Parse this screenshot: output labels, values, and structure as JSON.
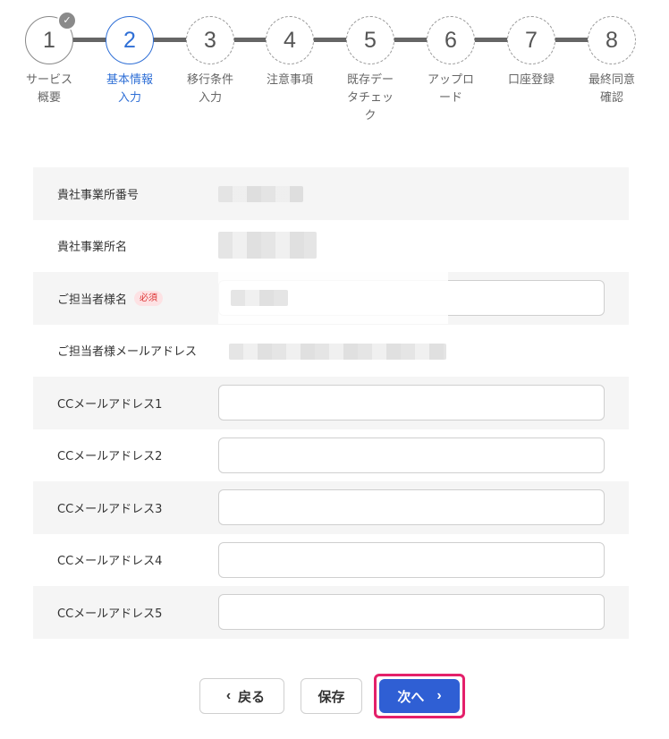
{
  "stepper": {
    "steps": [
      {
        "number": "1",
        "label": "サービス\n概要",
        "state": "done"
      },
      {
        "number": "2",
        "label": "基本情報\n入力",
        "state": "active"
      },
      {
        "number": "3",
        "label": "移行条件\n入力",
        "state": "todo"
      },
      {
        "number": "4",
        "label": "注意事項",
        "state": "todo"
      },
      {
        "number": "5",
        "label": "既存デー\nタチェッ\nク",
        "state": "todo"
      },
      {
        "number": "6",
        "label": "アップロ\nード",
        "state": "todo"
      },
      {
        "number": "7",
        "label": "口座登録",
        "state": "todo"
      },
      {
        "number": "8",
        "label": "最終同意\n確認",
        "state": "todo"
      }
    ],
    "check_glyph": "✓",
    "colors": {
      "active": "#2f6fd6",
      "line": "#666666"
    }
  },
  "form": {
    "rows": [
      {
        "label": "貴社事業所番号",
        "type": "readonly",
        "required": false
      },
      {
        "label": "貴社事業所名",
        "type": "readonly",
        "required": false
      },
      {
        "label": "ご担当者様名",
        "type": "input",
        "required": true,
        "value": ""
      },
      {
        "label": "ご担当者様メールアドレス",
        "type": "readonly",
        "required": false
      },
      {
        "label": "CCメールアドレス1",
        "type": "input",
        "required": false,
        "value": ""
      },
      {
        "label": "CCメールアドレス2",
        "type": "input",
        "required": false,
        "value": ""
      },
      {
        "label": "CCメールアドレス3",
        "type": "input",
        "required": false,
        "value": ""
      },
      {
        "label": "CCメールアドレス4",
        "type": "input",
        "required": false,
        "value": ""
      },
      {
        "label": "CCメールアドレス5",
        "type": "input",
        "required": false,
        "value": ""
      }
    ],
    "required_label": "必須"
  },
  "buttons": {
    "back_label": "戻る",
    "back_icon": "‹",
    "save_label": "保存",
    "next_label": "次へ",
    "next_icon": "›",
    "colors": {
      "primary": "#2f5fd4",
      "highlight": "#e4206a"
    }
  }
}
